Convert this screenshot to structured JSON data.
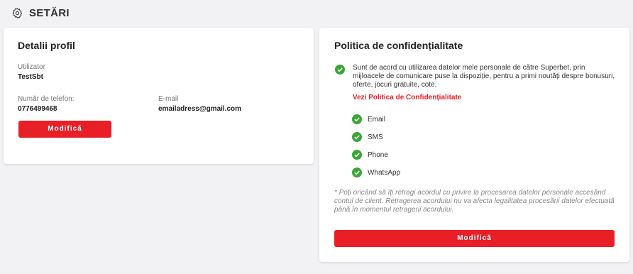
{
  "header": {
    "title": "SETĂRI",
    "icon": "gear-icon"
  },
  "profile": {
    "title": "Detalii profil",
    "username_label": "Utilizator",
    "username": "TestSbt",
    "phone_label": "Număr de telefon:",
    "phone": "0776499468",
    "email_label": "E-mail",
    "email": "emailadress@gmail.com",
    "edit_label": "Modifică"
  },
  "privacy": {
    "title": "Politica de confidențialitate",
    "consent_text": "Sunt de acord cu utilizarea datelor mele personale de către Superbet, prin mijloacele de comunicare puse la dispoziție, pentru a primi noutăți despre bonusuri, oferte, jocuri gratuite, cote.",
    "policy_link": "Vezi Politica de Confidențialitate",
    "channels": [
      "Email",
      "SMS",
      "Phone",
      "WhatsApp"
    ],
    "disclaimer": "* Poți oricând să îți retragi acordul cu privire la procesarea datelor personale accesând contul de client. Retragerea acordului nu va afecta legalitatea procesării datelor efectuată până în momentul retragerii acordului.",
    "edit_label": "Modifică"
  },
  "colors": {
    "accent": "#e81f26",
    "check": "#3aa635",
    "background": "#f2f2f4"
  }
}
